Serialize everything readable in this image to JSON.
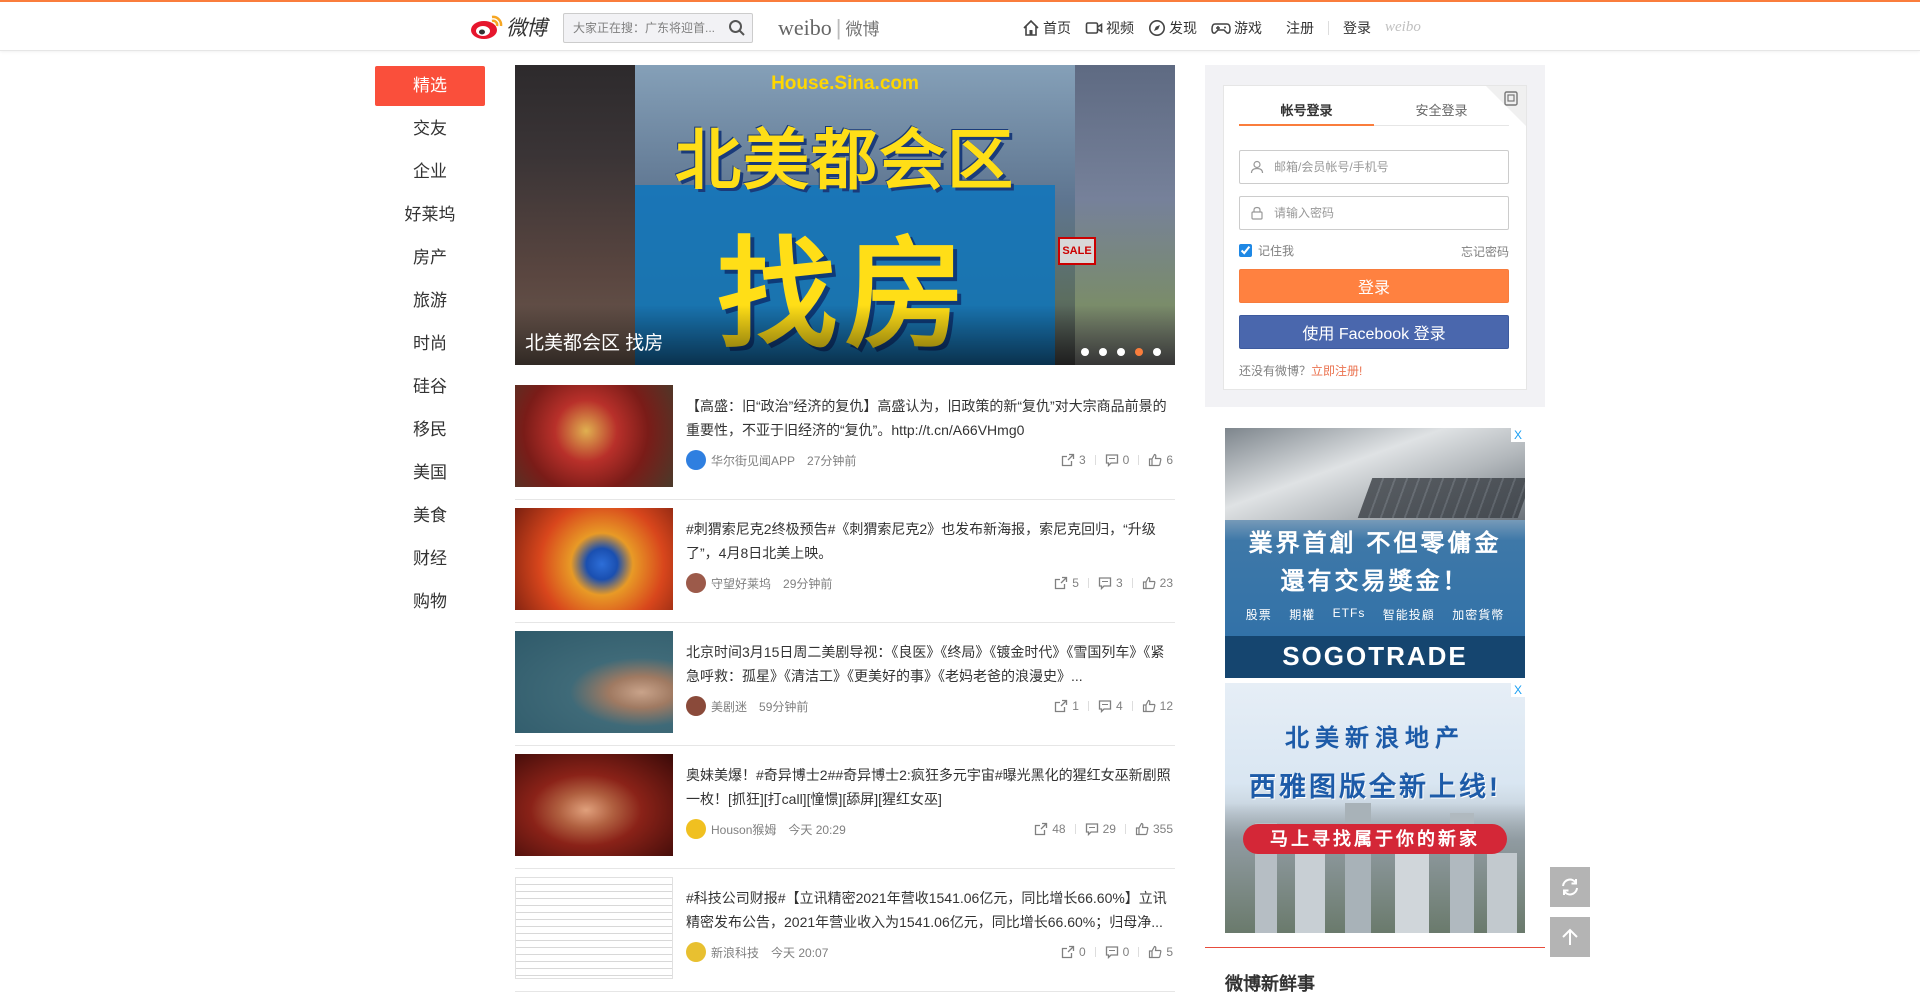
{
  "topbar": {
    "logo_text": "微博",
    "search_placeholder": "大家正在搜：广东将迎首...",
    "brand_latin": "weibo",
    "brand_cn": "微博",
    "nav": [
      {
        "label": "首页",
        "icon": "home-icon"
      },
      {
        "label": "视频",
        "icon": "video-icon"
      },
      {
        "label": "发现",
        "icon": "discover-icon"
      },
      {
        "label": "游戏",
        "icon": "game-icon"
      }
    ],
    "register": "注册",
    "login": "登录",
    "weibo_mark": "weibo"
  },
  "categories": [
    {
      "label": "精选",
      "active": true
    },
    {
      "label": "交友"
    },
    {
      "label": "企业"
    },
    {
      "label": "好莱坞"
    },
    {
      "label": "房产"
    },
    {
      "label": "旅游"
    },
    {
      "label": "时尚"
    },
    {
      "label": "硅谷"
    },
    {
      "label": "移民"
    },
    {
      "label": "美国"
    },
    {
      "label": "美食"
    },
    {
      "label": "财经"
    },
    {
      "label": "购物"
    }
  ],
  "carousel": {
    "site": "House.Sina.com",
    "headline_top": "北美都会区",
    "headline_main": "找房",
    "sale_sign": "SALE",
    "caption": "北美都会区 找房",
    "dots": 5,
    "active_dot": 4
  },
  "posts": [
    {
      "text": "【高盛：旧“政治”经济的复仇】高盛认为，旧政策的新“复仇”对大宗商品前景的重要性，不亚于旧经济的“复仇”。http://t.cn/A66VHmg0",
      "source": "华尔街见闻APP",
      "time": "27分钟前",
      "reposts": "3",
      "comments": "0",
      "likes": "6"
    },
    {
      "text": "#刺猬索尼克2终极预告#《刺猬索尼克2》也发布新海报，索尼克回归，“升级了”，4月8日北美上映。",
      "source": "守望好莱坞",
      "time": "29分钟前",
      "reposts": "5",
      "comments": "3",
      "likes": "23"
    },
    {
      "text": "北京时间3月15日周二美剧导视：《良医》《终局》《镀金时代》《雪国列车》《紧急呼救：孤星》《清洁工》《更美好的事》《老妈老爸的浪漫史》...",
      "source": "美剧迷",
      "time": "59分钟前",
      "reposts": "1",
      "comments": "4",
      "likes": "12"
    },
    {
      "text": "奥妹美爆！#奇异博士2##奇异博士2:疯狂多元宇宙#曝光黑化的猩红女巫新剧照一枚！[抓狂][打call][憧憬][舔屏][猩红女巫]",
      "source": "Houson猴姆",
      "time": "今天 20:29",
      "reposts": "48",
      "comments": "29",
      "likes": "355"
    },
    {
      "text": "#科技公司财报#【立讯精密2021年营收1541.06亿元，同比增长66.60%】立讯精密发布公告，2021年营业收入为1541.06亿元，同比增长66.60%；归母净...",
      "source": "新浪科技",
      "time": "今天 20:07",
      "reposts": "0",
      "comments": "0",
      "likes": "5"
    }
  ],
  "login": {
    "tab_account": "帐号登录",
    "tab_secure": "安全登录",
    "username_placeholder": "邮箱/会员帐号/手机号",
    "password_placeholder": "请输入密码",
    "remember": "记住我",
    "forgot": "忘记密码",
    "login_button": "登录",
    "facebook_button": "使用 Facebook 登录",
    "no_account": "还没有微博？",
    "register_now": "立即注册!"
  },
  "ad1": {
    "line1": "業界首創  不但零傭金",
    "line2": "還有交易獎金！",
    "tags": [
      "股票",
      "期權",
      "ETFs",
      "智能投顧",
      "加密貨幣"
    ],
    "brand": "SOGOTRADE",
    "close": "X"
  },
  "ad2": {
    "line1": "北美新浪地产",
    "line2": "西雅图版全新上线!",
    "pill": "马上寻找属于你的新家",
    "close": "X"
  },
  "fresh": {
    "title": "微博新鲜事"
  },
  "colors": {
    "accent": "#fa7d3c",
    "active_category": "#fa4f3b",
    "login_button": "#ff8140",
    "facebook_button": "#4a67ad",
    "register_link": "#eb7350"
  }
}
